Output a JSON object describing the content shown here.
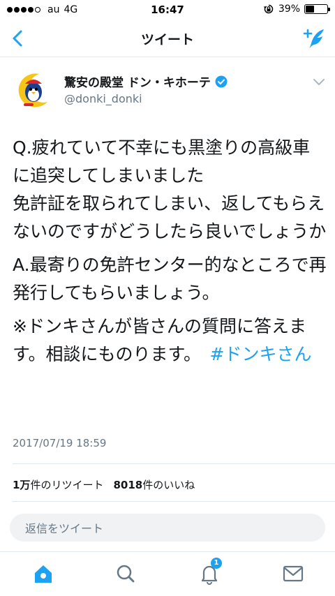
{
  "status_bar": {
    "carrier": "au",
    "network": "4G",
    "time": "16:47",
    "battery_percent": "39%",
    "battery_level": 0.39,
    "signal_bars_filled": 4,
    "signal_bars_total": 5
  },
  "nav": {
    "title": "ツイート",
    "back_icon": "chevron-left-icon",
    "compose_icon": "compose-tweet-icon"
  },
  "tweet": {
    "author_name": "驚安の殿堂 ドン・キホーテ",
    "author_handle": "@donki_donki",
    "verified": true,
    "paragraphs": [
      "Q.疲れていて不幸にも黒塗りの高級車に追突してしまいました\n免許証を取られてしまい、返してもらえないのですがどうしたら良いでしょうか",
      "A.最寄りの免許センター的なところで再発行してもらいましょう。",
      "※ドンキさんが皆さんの質問に答えます。相談にものります。　"
    ],
    "hashtag": "#ドンキさん",
    "timestamp": "2017/07/19 18:59",
    "retweets_count": "1万",
    "retweets_label": "件のリツイート",
    "likes_count": "8018",
    "likes_label": "件のいいね"
  },
  "reply": {
    "placeholder": "返信をツイート"
  },
  "tab_bar": {
    "accent_color": "#1da1f2",
    "notifications_badge": "1",
    "tabs": [
      "home-icon",
      "search-icon",
      "notifications-icon",
      "messages-icon"
    ]
  }
}
